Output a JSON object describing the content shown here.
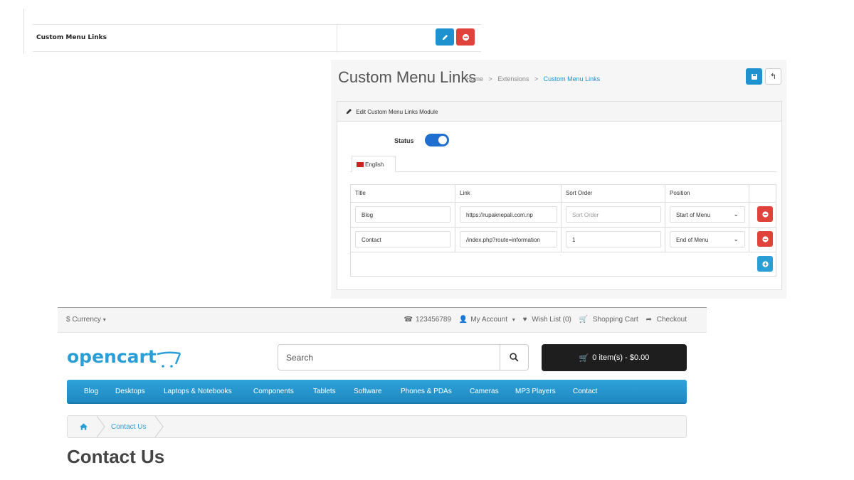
{
  "module_list": {
    "row_label": "Custom Menu Links",
    "edit_icon": "pencil-icon",
    "delete_icon": "minus-circle-icon"
  },
  "admin": {
    "title": "Custom Menu Links",
    "breadcrumb": [
      "Home",
      "Extensions",
      "Custom Menu Links"
    ],
    "save_icon": "save-icon",
    "back_icon": "reply-icon",
    "panel_heading": "Edit Custom Menu Links Module",
    "status_label": "Status",
    "status_on": true,
    "language_tab": "English",
    "columns": [
      "Title",
      "Link",
      "Sort Order",
      "Position"
    ],
    "rows": [
      {
        "title": "Blog",
        "link": "https://rupaknepali.com.np",
        "sort_order": "",
        "sort_placeholder": "Sort Order",
        "position": "Start of Menu"
      },
      {
        "title": "Contact",
        "link": "/index.php?route=information",
        "sort_order": "1",
        "sort_placeholder": "Sort Order",
        "position": "End of Menu"
      }
    ],
    "accent": "#1e91cf",
    "danger": "#e0433b"
  },
  "store": {
    "currency": "$ Currency",
    "phone": "123456789",
    "account": "My Account",
    "wishlist": "Wish List (0)",
    "cart_link": "Shopping Cart",
    "checkout": "Checkout",
    "logo": "opencart",
    "search_placeholder": "Search",
    "cart_button": "0 item(s) - $0.00",
    "menu": [
      "Blog",
      "Desktops",
      "Laptops & Notebooks",
      "Components",
      "Tablets",
      "Software",
      "Phones & PDAs",
      "Cameras",
      "MP3 Players",
      "Contact"
    ],
    "breadcrumb": "Contact Us",
    "heading": "Contact Us",
    "brand_color": "#2a9fd6"
  }
}
